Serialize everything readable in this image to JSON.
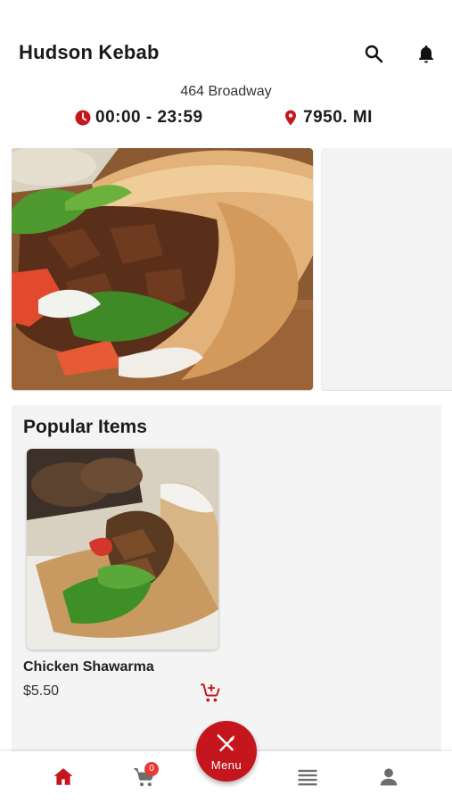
{
  "header": {
    "title": "Hudson Kebab",
    "search_icon": "search-icon",
    "notification_icon": "bell-icon"
  },
  "store": {
    "address": "464 Broadway",
    "hours": "00:00 - 23:59",
    "distance": "7950. MI",
    "hours_icon": "clock-icon",
    "distance_icon": "location-pin-icon"
  },
  "popular": {
    "title": "Popular Items",
    "items": [
      {
        "name": "Chicken Shawarma",
        "price": "$5.50"
      }
    ]
  },
  "bottom_nav": {
    "cart_count": "0",
    "menu_label": "Menu",
    "items": [
      "home-icon",
      "cart-icon",
      "menu-fab",
      "list-icon",
      "profile-icon"
    ]
  },
  "colors": {
    "accent": "#c4161c",
    "badge": "#e53935",
    "panel_bg": "#f4f4f4"
  }
}
